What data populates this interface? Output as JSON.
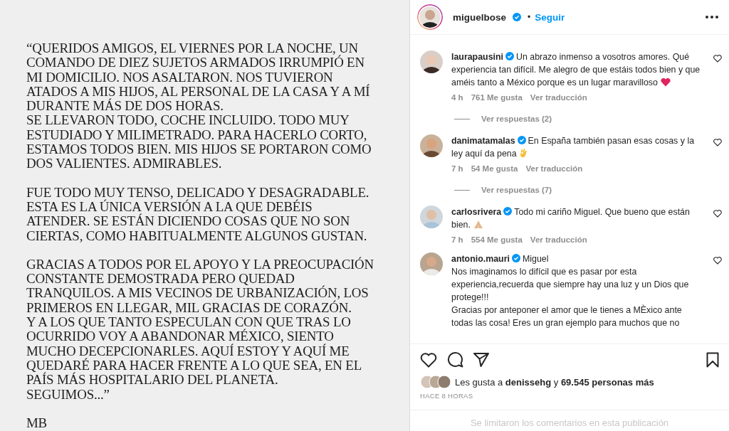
{
  "post_image": {
    "paragraphs": [
      {
        "lines": [
          "“QUERIDOS AMIGOS, EL VIERNES POR LA NOCHE, UN",
          "COMANDO DE DIEZ SUJETOS ARMADOS IRRUMPIÓ EN",
          "MI DOMICILIO. NOS ASALTARON. NOS TUVIERON",
          "ATADOS A MIS HIJOS, AL PERSONAL DE LA CASA Y A MÍ",
          "DURANTE MÁS DE DOS HORAS.",
          "SE LLEVARON TODO, COCHE INCLUIDO. TODO MUY",
          "ESTUDIADO Y MILIMETRADO. PARA HACERLO CORTO,",
          "ESTAMOS TODOS BIEN. MIS HIJOS SE PORTARON COMO",
          "DOS VALIENTES. ADMIRABLES."
        ]
      },
      {
        "lines": [
          "FUE TODO MUY TENSO, DELICADO Y DESAGRADABLE.",
          "ESTA ES LA ÚNICA VERSIÓN A LA QUE DEBÉIS",
          "ATENDER. SE ESTÁN DICIENDO COSAS QUE NO SON",
          "CIERTAS, COMO HABITUALMENTE ALGUNOS GUSTAN."
        ]
      },
      {
        "lines": [
          "GRACIAS A TODOS POR EL APOYO Y LA PREOCUPACIÓN",
          "CONSTANTE DEMOSTRADA PERO QUEDAD",
          "TRANQUILOS. A MIS VECINOS DE URBANIZACIÓN, LOS",
          "PRIMEROS EN LLEGAR, MIL GRACIAS DE CORAZÓN.",
          "Y A LOS QUE TANTO ESPECULAN CON QUE TRAS LO",
          "OCURRIDO VOY A ABANDONAR MÉXICO, SIENTO",
          "MUCHO DECEPCIONARLES. AQUÍ ESTOY Y AQUÍ ME",
          "QUEDARÉ PARA HACER FRENTE A LO QUE SEA, EN EL",
          "PAÍS MÁS HOSPITALARIO DEL PLANETA.",
          "SEGUIMOS...”"
        ]
      },
      {
        "lines": [
          "MB"
        ]
      }
    ]
  },
  "header": {
    "username": "miguelbose",
    "verified": true,
    "separator": "•",
    "follow": "Seguir"
  },
  "comments": [
    {
      "username": "laurapausini",
      "verified": true,
      "text": "Un abrazo inmenso a vosotros amores. Qué experiencia tan difícil. Me alegro de que estáis todos bien y que améis tanto a México porque es un lugar maravilloso",
      "kind": "heart",
      "time": "4 h",
      "likes": "761 Me gusta",
      "translate": "Ver traducción",
      "replies": "Ver respuestas (2)"
    },
    {
      "username": "danimatamalas",
      "verified": true,
      "text": "En España también pasan esas cosas y la ley aquí da pena",
      "kind": "ok-hand",
      "time": "7 h",
      "likes": "54 Me gusta",
      "translate": "Ver traducción",
      "replies": "Ver respuestas (7)"
    },
    {
      "username": "carlosrivera",
      "verified": true,
      "text": "Todo mi cariño Miguel. Que bueno que están bien.",
      "kind": "pray",
      "time": "7 h",
      "likes": "554 Me gusta",
      "translate": "Ver traducción"
    },
    {
      "username": "antonio.mauri",
      "kind": "plain",
      "verified": true,
      "text": "Miguel\nNos imaginamos lo difícil que es pasar por esta experiencia,recuerda que siempre hay una luz y un Dios que protege!!!\nGracias por anteponer el amor que le tienes a MÈxico ante todas las cosa! Eres un gran ejemplo para muchos que no"
    }
  ],
  "likes": {
    "prefix": "Les gusta a",
    "user": "denissehg",
    "joiner": "y",
    "count": "69.545 personas más"
  },
  "timestamp": "HACE 8 HORAS",
  "comments_notice": "Se limitaron los comentarios en esta publicación"
}
